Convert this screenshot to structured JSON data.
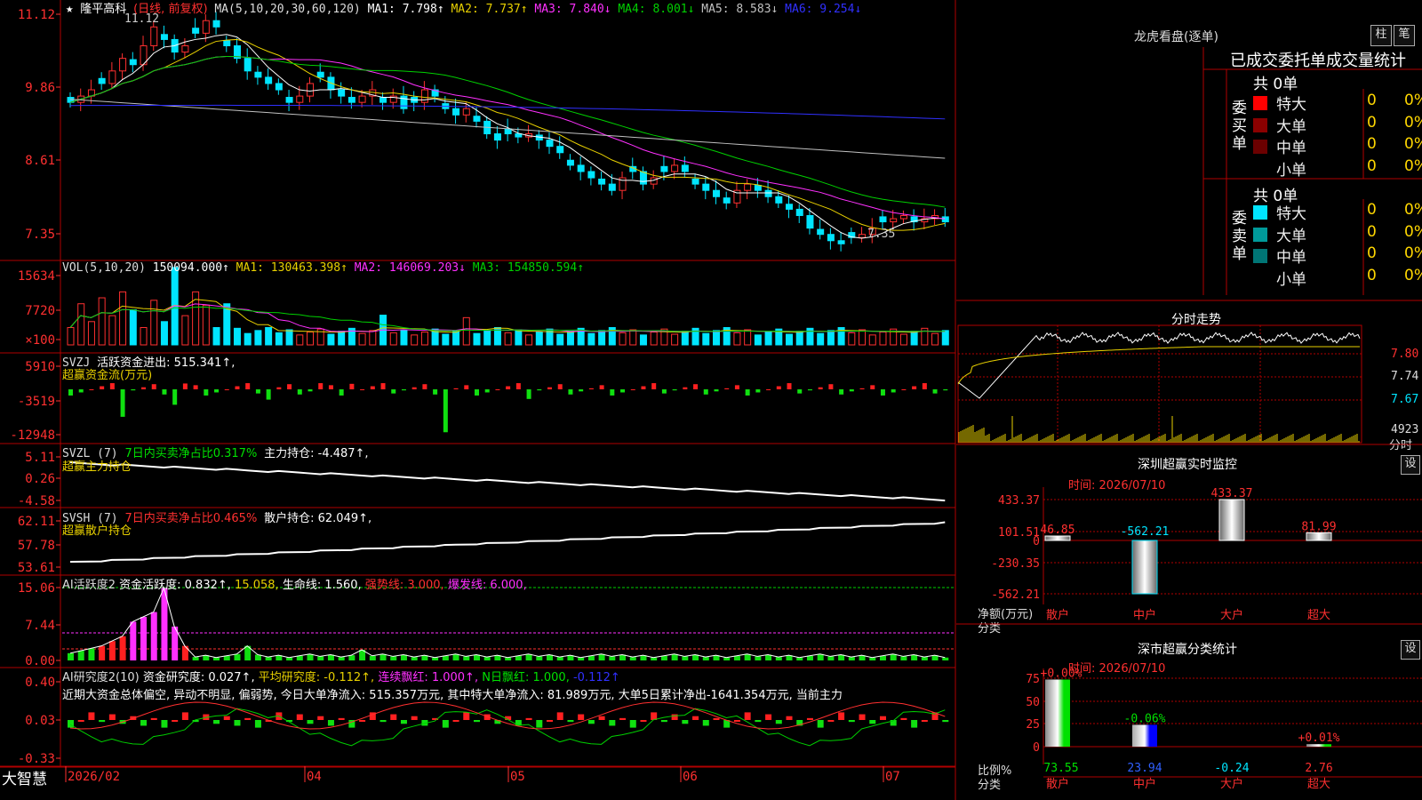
{
  "colors": {
    "up": "#ff3030",
    "down": "#00e5ff",
    "ma1": "#ffffff",
    "ma2": "#e8d000",
    "ma3": "#ff30ff",
    "ma4": "#00d000",
    "ma5": "#c0c0c0",
    "ma6": "#3030ff",
    "grid": "#b00000",
    "bull": "#ff2020",
    "bear": "#10e010"
  },
  "kline": {
    "title_star": "★",
    "stock": "隆平高科",
    "period": "(日线, 前复权)",
    "ma_spec": "MA(5,10,20,30,60,120)",
    "ma1": "MA1: 7.798↑",
    "ma2": "MA2: 7.737↑",
    "ma3": "MA3: 7.840↓",
    "ma4": "MA4: 8.001↓",
    "ma5": "MA5: 8.583↓",
    "ma6": "MA6: 9.254↓",
    "yticks": [
      "11.12",
      "9.86",
      "8.61",
      "7.35"
    ],
    "high_label": "11.12",
    "low_label": "7.35"
  },
  "vol": {
    "spec": "VOL(5,10,20)",
    "value": "150094.000↑",
    "ma1": "MA1: 130463.398↑",
    "ma2": "MA2: 146069.203↓",
    "ma3": "MA3: 154850.594↑",
    "yticks": [
      "15634",
      "7720",
      "×100"
    ]
  },
  "svzj": {
    "spec": "SVZJ",
    "line": "活跃资金进出: 515.341↑,",
    "sub": "超赢资金流(万元)",
    "yticks": [
      "5910",
      "-3519",
      "-12948"
    ]
  },
  "svzl": {
    "spec": "SVZL (7)",
    "pct": "7日内买卖净占比0.317%",
    "line": "主力持仓: -4.487↑,",
    "sub": "超赢主力持仓",
    "yticks": [
      "5.11",
      "0.26",
      "-4.58"
    ]
  },
  "svsh": {
    "spec": "SVSH (7)",
    "pct": "7日内买卖净占比0.465%",
    "line": "散户持仓: 62.049↑,",
    "sub": "超赢散户持仓",
    "yticks": [
      "62.11",
      "57.78",
      "53.61"
    ]
  },
  "ai1": {
    "spec": "AI活跃度2",
    "a": "资金活跃度: 0.832↑,",
    "b": "15.058,",
    "c": "生命线: 1.560,",
    "d": "强势线: 3.000,",
    "e": "爆发线: 6.000,",
    "yticks": [
      "15.06",
      "7.44",
      "0.00"
    ]
  },
  "ai2": {
    "spec": "AI研究度2(10)",
    "a": "资金研究度: 0.027↑,",
    "b": "平均研究度: -0.112↑,",
    "c": "连续飘红: 1.000↑,",
    "d": "N日飘红: 1.000,",
    "e": "-0.112↑",
    "desc": "近期大资金总体偏空, 异动不明显, 偏弱势, 今日大单净流入: 515.357万元, 其中特大单净流入: 81.989万元, 大单5日累计净出-1641.354万元, 当前主力",
    "yticks": [
      "0.40",
      "0.03",
      "-0.33"
    ]
  },
  "xaxis": {
    "labels": [
      "2026/02",
      "04",
      "05",
      "06",
      "07"
    ]
  },
  "footer": {
    "brand": "大智慧"
  },
  "rp": {
    "title": "龙虎看盘(逐单)",
    "btn1": "柱",
    "btn2": "笔",
    "tabs": "已成交委托单成交量统计",
    "buy_total": "共 0单",
    "sell_total": "共 0单",
    "buy_side": "委买单",
    "sell_side": "委卖单",
    "buy_rows": [
      {
        "label": "特大",
        "n": "0",
        "p": "0%",
        "c": "#ff0000"
      },
      {
        "label": "大单",
        "n": "0",
        "p": "0%",
        "c": "#8b0000"
      },
      {
        "label": "中单",
        "n": "0",
        "p": "0%",
        "c": "#6b0000"
      },
      {
        "label": "小单",
        "n": "0",
        "p": "0%",
        "c": "#000000"
      }
    ],
    "sell_rows": [
      {
        "label": "特大",
        "n": "0",
        "p": "0%",
        "c": "#00e5ff"
      },
      {
        "label": "大单",
        "n": "0",
        "p": "0%",
        "c": "#009a9a"
      },
      {
        "label": "中单",
        "n": "0",
        "p": "0%",
        "c": "#007575"
      },
      {
        "label": "小单",
        "n": "0",
        "p": "0%",
        "c": "#000000"
      }
    ]
  },
  "intraday": {
    "title": "分时走势",
    "yticks": [
      "7.80",
      "7.74",
      "7.67"
    ],
    "vol_label": "4923",
    "vol_unit": "分时"
  },
  "szmon": {
    "title": "深圳超赢实时监控",
    "btn": "设",
    "time": "时间: 2026/07/10",
    "yticks": [
      "433.37",
      "101.51",
      "0",
      "-230.35",
      "-562.21"
    ],
    "ylabel": "净额(万元)",
    "xlabel_title": "分类",
    "cats": [
      "散户",
      "中户",
      "大户",
      "超大"
    ],
    "vals": [
      46.85,
      -562.21,
      433.37,
      81.99
    ],
    "val_labels": [
      "46.85",
      "-562.21",
      "433.37",
      "81.99"
    ]
  },
  "szstat": {
    "title": "深市超赢分类统计",
    "btn": "设",
    "time": "时间: 2026/07/10",
    "yticks": [
      "75",
      "50",
      "25",
      "0"
    ],
    "ylabel": "比例%",
    "xlabel_title": "分类",
    "cats": [
      "散户",
      "中户",
      "大户",
      "超大"
    ],
    "vals": [
      73.55,
      23.94,
      -0.24,
      2.76
    ],
    "val_labels": [
      "73.55",
      "23.94",
      "-0.24",
      "2.76"
    ],
    "delta": [
      "+0.00%",
      "-0.06%",
      "",
      "+0.01%"
    ]
  },
  "chart_data": [
    {
      "type": "candlestick",
      "title": "隆平高科 (日线, 前复权)",
      "ylim": [
        7.2,
        11.3
      ],
      "high": 11.12,
      "low": 7.35,
      "ma": {
        "MA1": 7.798,
        "MA2": 7.737,
        "MA3": 7.84,
        "MA4": 8.001,
        "MA5": 8.583,
        "MA6": 9.254
      },
      "closes": [
        9.7,
        9.8,
        9.9,
        10.0,
        10.2,
        10.4,
        10.3,
        10.6,
        10.9,
        10.7,
        10.5,
        10.6,
        10.8,
        11.0,
        10.9,
        10.6,
        10.4,
        10.2,
        10.1,
        10.0,
        9.9,
        9.7,
        9.8,
        10.0,
        10.1,
        9.9,
        9.8,
        9.7,
        9.8,
        9.9,
        9.7,
        9.8,
        9.6,
        9.7,
        9.9,
        9.8,
        9.6,
        9.5,
        9.6,
        9.4,
        9.2,
        9.1,
        9.2,
        9.15,
        9.2,
        9.1,
        9.0,
        8.9,
        8.7,
        8.6,
        8.5,
        8.4,
        8.3,
        8.5,
        8.6,
        8.4,
        8.5,
        8.6,
        8.7,
        8.6,
        8.4,
        8.3,
        8.2,
        8.1,
        8.3,
        8.4,
        8.3,
        8.2,
        8.1,
        8.0,
        7.9,
        7.7,
        7.6,
        7.5,
        7.45,
        7.55,
        7.6,
        7.7,
        7.8,
        7.85,
        7.9,
        7.8,
        7.85,
        7.9,
        7.8
      ]
    },
    {
      "type": "bar",
      "title": "VOL(5,10,20)",
      "ylim": [
        0,
        16500
      ],
      "ma": {
        "MA1": 130463.398,
        "MA2": 146069.203,
        "MA3": 154850.594
      }
    },
    {
      "type": "bar",
      "title": "SVZJ 活跃资金进出",
      "ylim": [
        -12948,
        5910
      ]
    },
    {
      "type": "line",
      "title": "SVZL 主力持仓",
      "ylim": [
        -4.58,
        5.11
      ]
    },
    {
      "type": "line",
      "title": "SVSH 散户持仓",
      "ylim": [
        53.61,
        62.11
      ]
    },
    {
      "type": "bar",
      "title": "AI活跃度2",
      "ylim": [
        0,
        15.06
      ]
    },
    {
      "type": "bar",
      "title": "AI研究度2(10)",
      "ylim": [
        -0.33,
        0.4
      ]
    },
    {
      "type": "bar",
      "title": "深圳超赢实时监控",
      "categories": [
        "散户",
        "中户",
        "大户",
        "超大"
      ],
      "values": [
        46.85,
        -562.21,
        433.37,
        81.99
      ],
      "ylim": [
        -562.21,
        433.37
      ]
    },
    {
      "type": "bar",
      "title": "深市超赢分类统计",
      "categories": [
        "散户",
        "中户",
        "大户",
        "超大"
      ],
      "values": [
        73.55,
        23.94,
        -0.24,
        2.76
      ],
      "ylim": [
        0,
        75
      ]
    }
  ]
}
